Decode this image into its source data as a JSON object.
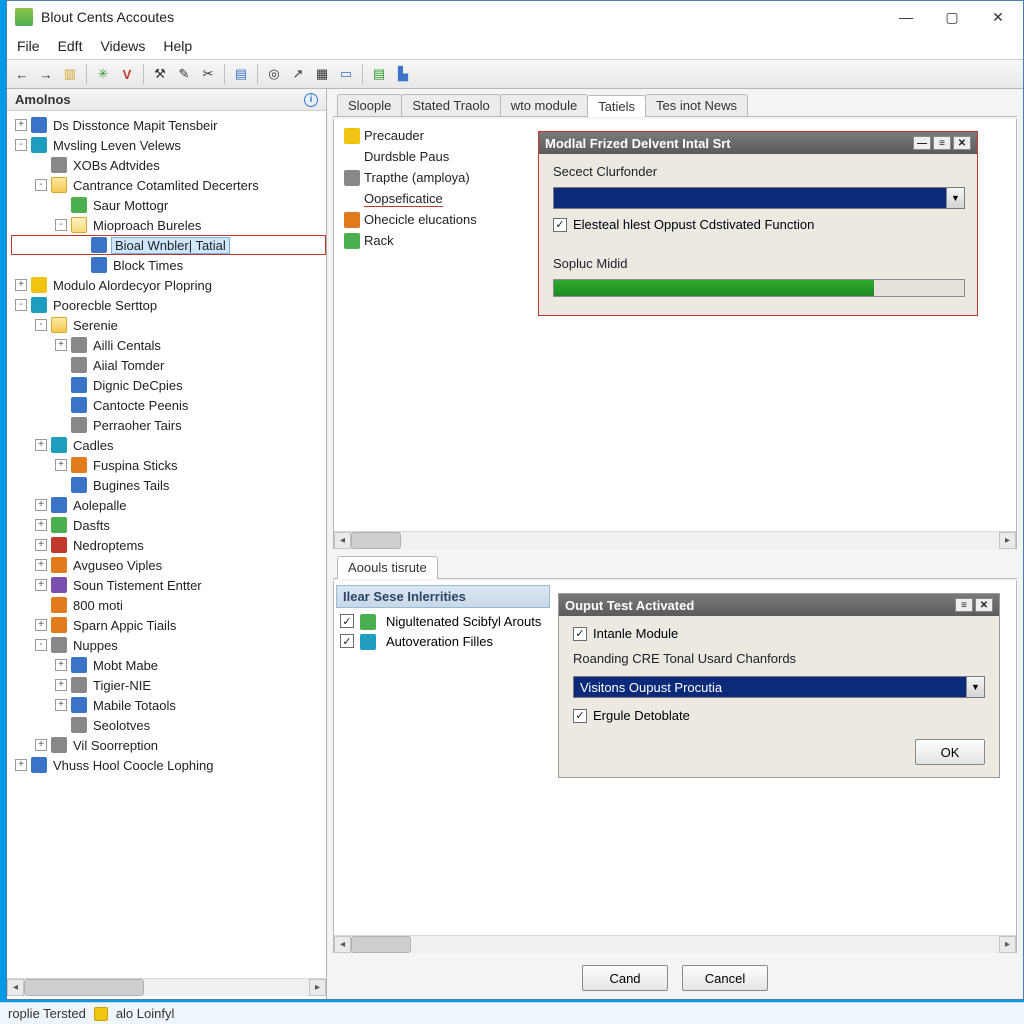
{
  "window": {
    "title": "Blout Cents Accoutes"
  },
  "menu": {
    "file": "File",
    "edit": "Edft",
    "views": "Videws",
    "help": "Help"
  },
  "sidebar": {
    "header": "Amolnos",
    "tree": [
      {
        "d": 0,
        "e": "+",
        "ic": "blue",
        "t": "Ds Disstonce Mapit Tensbeir"
      },
      {
        "d": 0,
        "e": "-",
        "ic": "cyan",
        "t": "Mvsling Leven Velews"
      },
      {
        "d": 1,
        "e": " ",
        "ic": "grey",
        "t": "XOBs Adtvides"
      },
      {
        "d": 1,
        "e": "-",
        "ic": "folder",
        "t": "Cantrance Cotamlited Decerters"
      },
      {
        "d": 2,
        "e": " ",
        "ic": "green",
        "t": "Saur Mottogr"
      },
      {
        "d": 2,
        "e": "-",
        "ic": "folder-open",
        "t": "Mioproach Bureles"
      },
      {
        "d": 3,
        "e": " ",
        "ic": "blue",
        "t": "Bioal Wnbler| Tatial",
        "sel": true,
        "box": true
      },
      {
        "d": 3,
        "e": " ",
        "ic": "blue",
        "t": "Block Times"
      },
      {
        "d": 0,
        "e": "+",
        "ic": "yellow",
        "t": "Modulo Alordecyor Plopring"
      },
      {
        "d": 0,
        "e": "-",
        "ic": "cyan",
        "t": "Poorecble Serttop"
      },
      {
        "d": 1,
        "e": "-",
        "ic": "folder",
        "t": "Serenie"
      },
      {
        "d": 2,
        "e": "+",
        "ic": "grey",
        "t": "Ailli Centals"
      },
      {
        "d": 2,
        "e": " ",
        "ic": "grey",
        "t": "Aiial Tomder"
      },
      {
        "d": 2,
        "e": " ",
        "ic": "blue",
        "t": "Dignic DeCpies"
      },
      {
        "d": 2,
        "e": " ",
        "ic": "blue",
        "t": "Cantocte Peenis"
      },
      {
        "d": 2,
        "e": " ",
        "ic": "grey",
        "t": "Perraoher Tairs"
      },
      {
        "d": 1,
        "e": "+",
        "ic": "cyan",
        "t": "Cadles"
      },
      {
        "d": 2,
        "e": "+",
        "ic": "orange",
        "t": "Fuspina Sticks"
      },
      {
        "d": 2,
        "e": " ",
        "ic": "blue",
        "t": "Bugines Tails"
      },
      {
        "d": 1,
        "e": "+",
        "ic": "blue",
        "t": "Aolepalle"
      },
      {
        "d": 1,
        "e": "+",
        "ic": "green",
        "t": "Dasfts"
      },
      {
        "d": 1,
        "e": "+",
        "ic": "red",
        "t": "Nedroptems"
      },
      {
        "d": 1,
        "e": "+",
        "ic": "orange",
        "t": "Avguseo Viples"
      },
      {
        "d": 1,
        "e": "+",
        "ic": "purple",
        "t": "Soun Tistement Entter"
      },
      {
        "d": 1,
        "e": " ",
        "ic": "orange",
        "t": "800 moti"
      },
      {
        "d": 1,
        "e": "+",
        "ic": "orange",
        "t": "Sparn Appic Tiails"
      },
      {
        "d": 1,
        "e": "-",
        "ic": "grey",
        "t": "Nuppes"
      },
      {
        "d": 2,
        "e": "+",
        "ic": "blue",
        "t": "Mobt Mabe"
      },
      {
        "d": 2,
        "e": "+",
        "ic": "grey",
        "t": "Tigier-NIE"
      },
      {
        "d": 2,
        "e": "+",
        "ic": "blue",
        "t": "Mabile Totaols"
      },
      {
        "d": 2,
        "e": " ",
        "ic": "grey",
        "t": "Seolotves"
      },
      {
        "d": 1,
        "e": "+",
        "ic": "grey",
        "t": "Vil Soorreption"
      },
      {
        "d": 0,
        "e": "+",
        "ic": "blue",
        "t": "Vhuss Hool Coocle Lophing"
      }
    ]
  },
  "tabs_upper": [
    "Sloople",
    "Stated Traolo",
    "wto module",
    "Tatiels",
    "Tes inot News"
  ],
  "tabs_upper_active": 3,
  "mini_tree": [
    {
      "ic": "yellow",
      "t": "Precauder"
    },
    {
      "ic": "",
      "t": "Durdsble Paus"
    },
    {
      "ic": "grey",
      "t": "Trapthe (amploya)"
    },
    {
      "ic": "",
      "t": "Oopseficatice",
      "under": true
    },
    {
      "ic": "orange",
      "t": "Ohecicle elucations"
    },
    {
      "ic": "green",
      "t": "Rack"
    }
  ],
  "dlg1": {
    "title": "Modlal Frized Delvent Intal Srt",
    "field1": "Secect Clurfonder",
    "combo1": "",
    "chk1": "Elesteal hlest Oppust Cdstivated Function",
    "field2": "Sopluc Midid",
    "progress_pct": 78
  },
  "tabs_mid": [
    "Aoouls tisrute"
  ],
  "lower_left": {
    "header": "Ilear Sese Inlerrities",
    "items": [
      {
        "chk": true,
        "ic": "green",
        "t": "Nigultenated Scibfyl Arouts"
      },
      {
        "chk": true,
        "ic": "cyan",
        "t": "Autoveration Filles"
      }
    ]
  },
  "dlg2": {
    "title": "Ouput Test Activated",
    "chk1": "Intanle Module",
    "field1": "Roanding CRE Tonal Usard Chanfords",
    "combo1": "Visitons Oupust Procutia",
    "chk2": "Ergule Detoblate",
    "ok": "OK"
  },
  "bottom": {
    "cand": "Cand",
    "cancel": "Cancel"
  },
  "status": {
    "a": "roplie Tersted",
    "b": "alo Loinfyl"
  }
}
